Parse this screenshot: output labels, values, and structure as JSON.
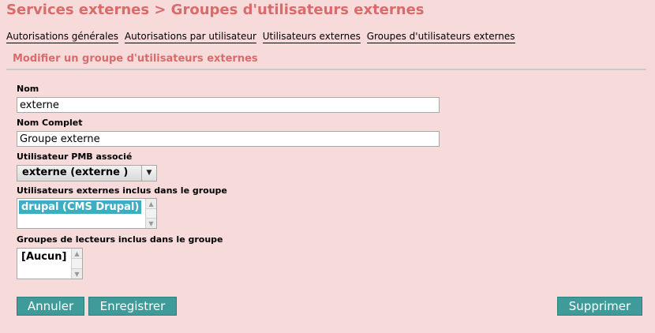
{
  "page": {
    "title": "Services externes > Groupes d'utilisateurs externes"
  },
  "tabs": [
    {
      "label": "Autorisations générales"
    },
    {
      "label": "Autorisations par utilisateur"
    },
    {
      "label": "Utilisateurs externes"
    },
    {
      "label": "Groupes d'utilisateurs externes"
    }
  ],
  "form": {
    "section_title": "Modifier un groupe d'utilisateurs externes",
    "nom": {
      "label": "Nom",
      "value": "externe"
    },
    "nom_complet": {
      "label": "Nom Complet",
      "value": "Groupe externe"
    },
    "utilisateur_pmb": {
      "label": "Utilisateur PMB associé",
      "selected": "externe (externe )"
    },
    "utilisateurs_externes": {
      "label": "Utilisateurs externes inclus dans le groupe",
      "items": [
        "drupal (CMS Drupal)"
      ]
    },
    "groupes_lecteurs": {
      "label": "Groupes de lecteurs inclus dans le groupe",
      "items": [
        "[Aucun]"
      ]
    }
  },
  "buttons": {
    "annuler": "Annuler",
    "enregistrer": "Enregistrer",
    "supprimer": "Supprimer"
  },
  "colors": {
    "background": "#f7dada",
    "title": "#d86b6b",
    "button": "#3e9b9a",
    "selection": "#3eadc2"
  },
  "icons": {
    "dropdown": "chevron-down-icon",
    "scroll_up": "arrow-up-icon",
    "scroll_down": "arrow-down-icon"
  }
}
